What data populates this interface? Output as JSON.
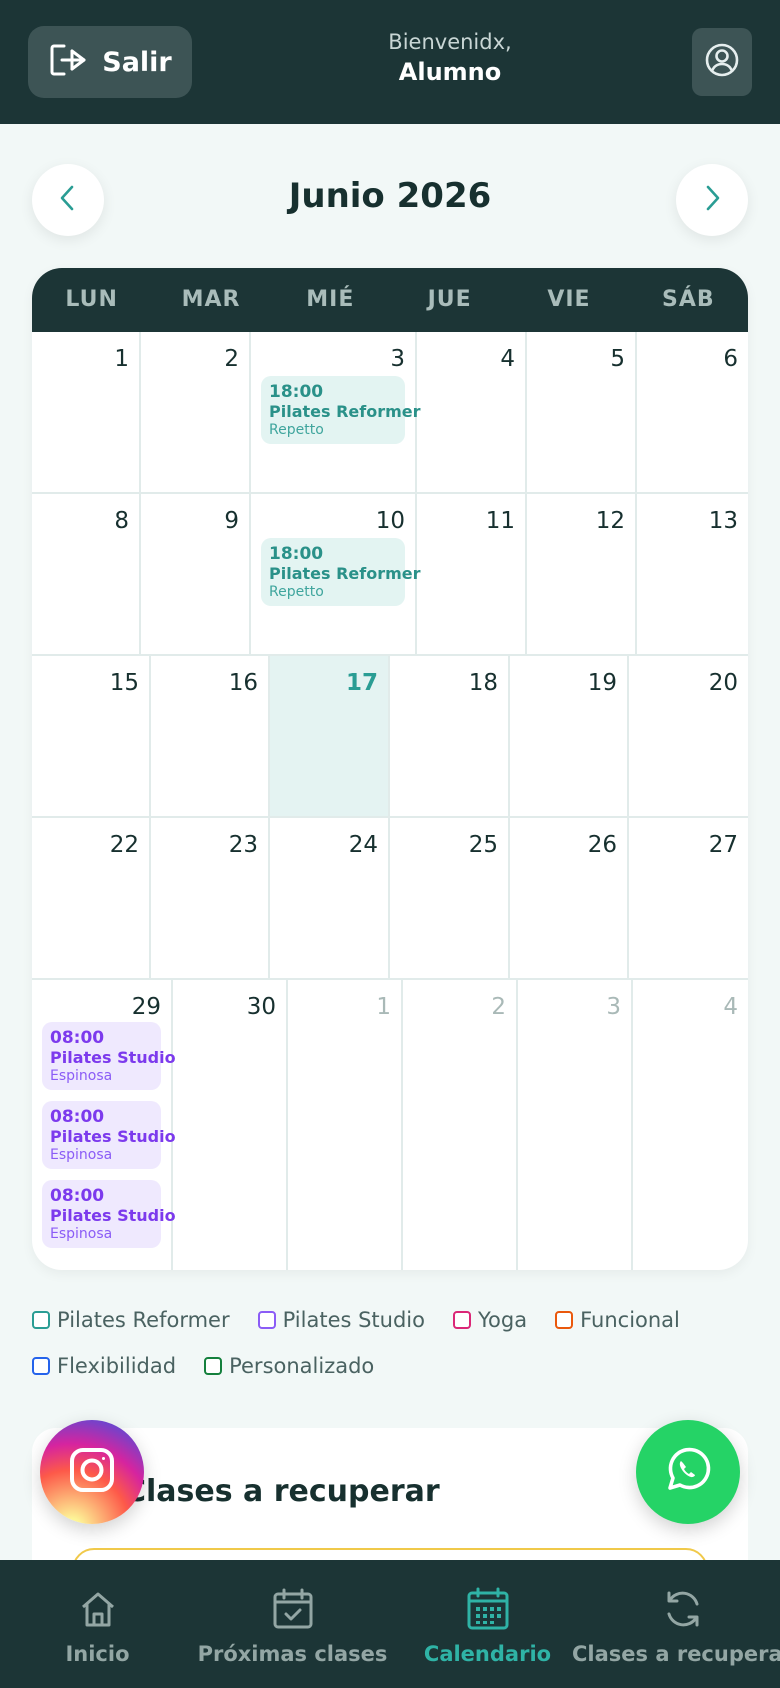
{
  "header": {
    "logout_label": "Salir",
    "welcome_line": "Bienvenidx,",
    "user_name": "Alumno"
  },
  "calendar": {
    "month_title": "Junio 2026",
    "weekdays": [
      "LUN",
      "MAR",
      "MIÉ",
      "JUE",
      "VIE",
      "SÁB"
    ],
    "weeks": [
      [
        {
          "day": "1"
        },
        {
          "day": "2"
        },
        {
          "day": "3",
          "events": [
            {
              "time": "18:00",
              "name": "Pilates Reformer",
              "instructor": "Repetto",
              "type": "reformer"
            }
          ]
        },
        {
          "day": "4"
        },
        {
          "day": "5"
        },
        {
          "day": "6"
        }
      ],
      [
        {
          "day": "8"
        },
        {
          "day": "9"
        },
        {
          "day": "10",
          "events": [
            {
              "time": "18:00",
              "name": "Pilates Reformer",
              "instructor": "Repetto",
              "type": "reformer"
            }
          ]
        },
        {
          "day": "11"
        },
        {
          "day": "12"
        },
        {
          "day": "13"
        }
      ],
      [
        {
          "day": "15"
        },
        {
          "day": "16"
        },
        {
          "day": "17",
          "today": true
        },
        {
          "day": "18"
        },
        {
          "day": "19"
        },
        {
          "day": "20"
        }
      ],
      [
        {
          "day": "22"
        },
        {
          "day": "23"
        },
        {
          "day": "24"
        },
        {
          "day": "25"
        },
        {
          "day": "26"
        },
        {
          "day": "27"
        }
      ],
      [
        {
          "day": "29",
          "events": [
            {
              "time": "08:00",
              "name": "Pilates Studio",
              "instructor": "Espinosa",
              "type": "studio"
            },
            {
              "time": "08:00",
              "name": "Pilates Studio",
              "instructor": "Espinosa",
              "type": "studio"
            },
            {
              "time": "08:00",
              "name": "Pilates Studio",
              "instructor": "Espinosa",
              "type": "studio"
            }
          ]
        },
        {
          "day": "30"
        },
        {
          "day": "1",
          "other": true
        },
        {
          "day": "2",
          "other": true
        },
        {
          "day": "3",
          "other": true
        },
        {
          "day": "4",
          "other": true
        }
      ]
    ]
  },
  "legend": [
    {
      "label": "Pilates Reformer",
      "color": "#2a9d94"
    },
    {
      "label": "Pilates Studio",
      "color": "#8b5cf6"
    },
    {
      "label": "Yoga",
      "color": "#db2777"
    },
    {
      "label": "Funcional",
      "color": "#ea580c"
    },
    {
      "label": "Flexibilidad",
      "color": "#2563eb"
    },
    {
      "label": "Personalizado",
      "color": "#15803d"
    }
  ],
  "recover": {
    "title": "Clases a recuperar"
  },
  "bottom_nav": [
    {
      "label": "Inicio",
      "icon": "home-icon"
    },
    {
      "label": "Próximas clases",
      "icon": "calendar-check-icon"
    },
    {
      "label": "Calendario",
      "icon": "calendar-grid-icon",
      "active": true
    },
    {
      "label": "Clases a recuperar",
      "icon": "refresh-icon"
    }
  ],
  "colors": {
    "primary_dark": "#1c3536",
    "accent_teal": "#2a9d94",
    "studio_purple": "#7c3aed",
    "whatsapp_green": "#25d366"
  }
}
